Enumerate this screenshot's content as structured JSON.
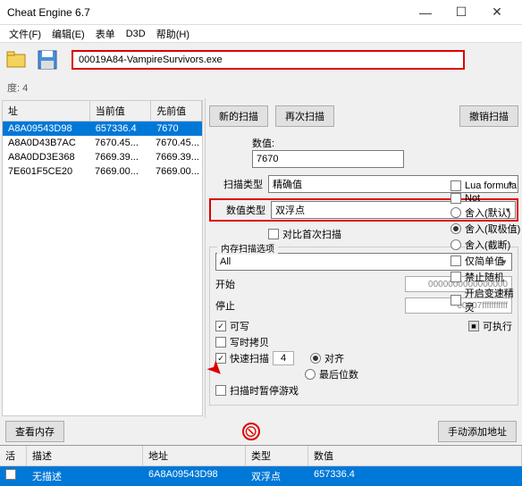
{
  "window": {
    "title": "Cheat Engine 6.7",
    "min": "—",
    "max": "☐",
    "close": "✕"
  },
  "menu": {
    "file": "文件(F)",
    "edit": "编辑(E)",
    "table": "表单",
    "d3d": "D3D",
    "help": "帮助(H)"
  },
  "process": {
    "name": "00019A84-VampireSurvivors.exe"
  },
  "progress": {
    "label": "度: 4"
  },
  "resultTable": {
    "h_addr": "址",
    "h_cur": "当前值",
    "h_prev": "先前值",
    "rows": [
      {
        "addr": "A8A09543D98",
        "cur": "657336.4",
        "prev": "7670"
      },
      {
        "addr": "A8A0D43B7AC",
        "cur": "7670.45...",
        "prev": "7670.45..."
      },
      {
        "addr": "A8A0DD3E368",
        "cur": "7669.39...",
        "prev": "7669.39..."
      },
      {
        "addr": "7E601F5CE20",
        "cur": "7669.00...",
        "prev": "7669.00..."
      }
    ]
  },
  "scan": {
    "new": "新的扫描",
    "again": "再次扫描",
    "undo": "撤销扫描",
    "valueLabel": "数值:",
    "value": "7670",
    "scanTypeLabel": "扫描类型",
    "scanType": "精确值",
    "valueTypeLabel": "数值类型",
    "valueType": "双浮点",
    "compareFirst": "对比首次扫描"
  },
  "opts": {
    "lua": "Lua formula",
    "not": "Not",
    "roundDefault": "舍入(默认)",
    "roundExtreme": "舍入(取极值)",
    "roundTrunc": "舍入(截断)",
    "simple": "仅简单值",
    "noRandom": "禁止随机",
    "speedhack": "开启变速精灵"
  },
  "mem": {
    "legend": "内存扫描选项",
    "all": "All",
    "startLabel": "开始",
    "start": "0000000000000000",
    "stopLabel": "停止",
    "stop": "00007fffffffffff",
    "writable": "可写",
    "executable": "可执行",
    "cow": "写时拷贝",
    "fast": "快速扫描",
    "fastVal": "4",
    "align": "对齐",
    "lastDigit": "最后位数",
    "pause": "扫描时暂停游戏"
  },
  "bottom": {
    "viewMem": "查看内存",
    "addManual": "手动添加地址"
  },
  "addrList": {
    "h_active": "活",
    "h_desc": "描述",
    "h_addr": "地址",
    "h_type": "类型",
    "h_val": "数值",
    "row": {
      "desc": "无描述",
      "addr": "6A8A09543D98",
      "type": "双浮点",
      "val": "657336.4"
    }
  }
}
